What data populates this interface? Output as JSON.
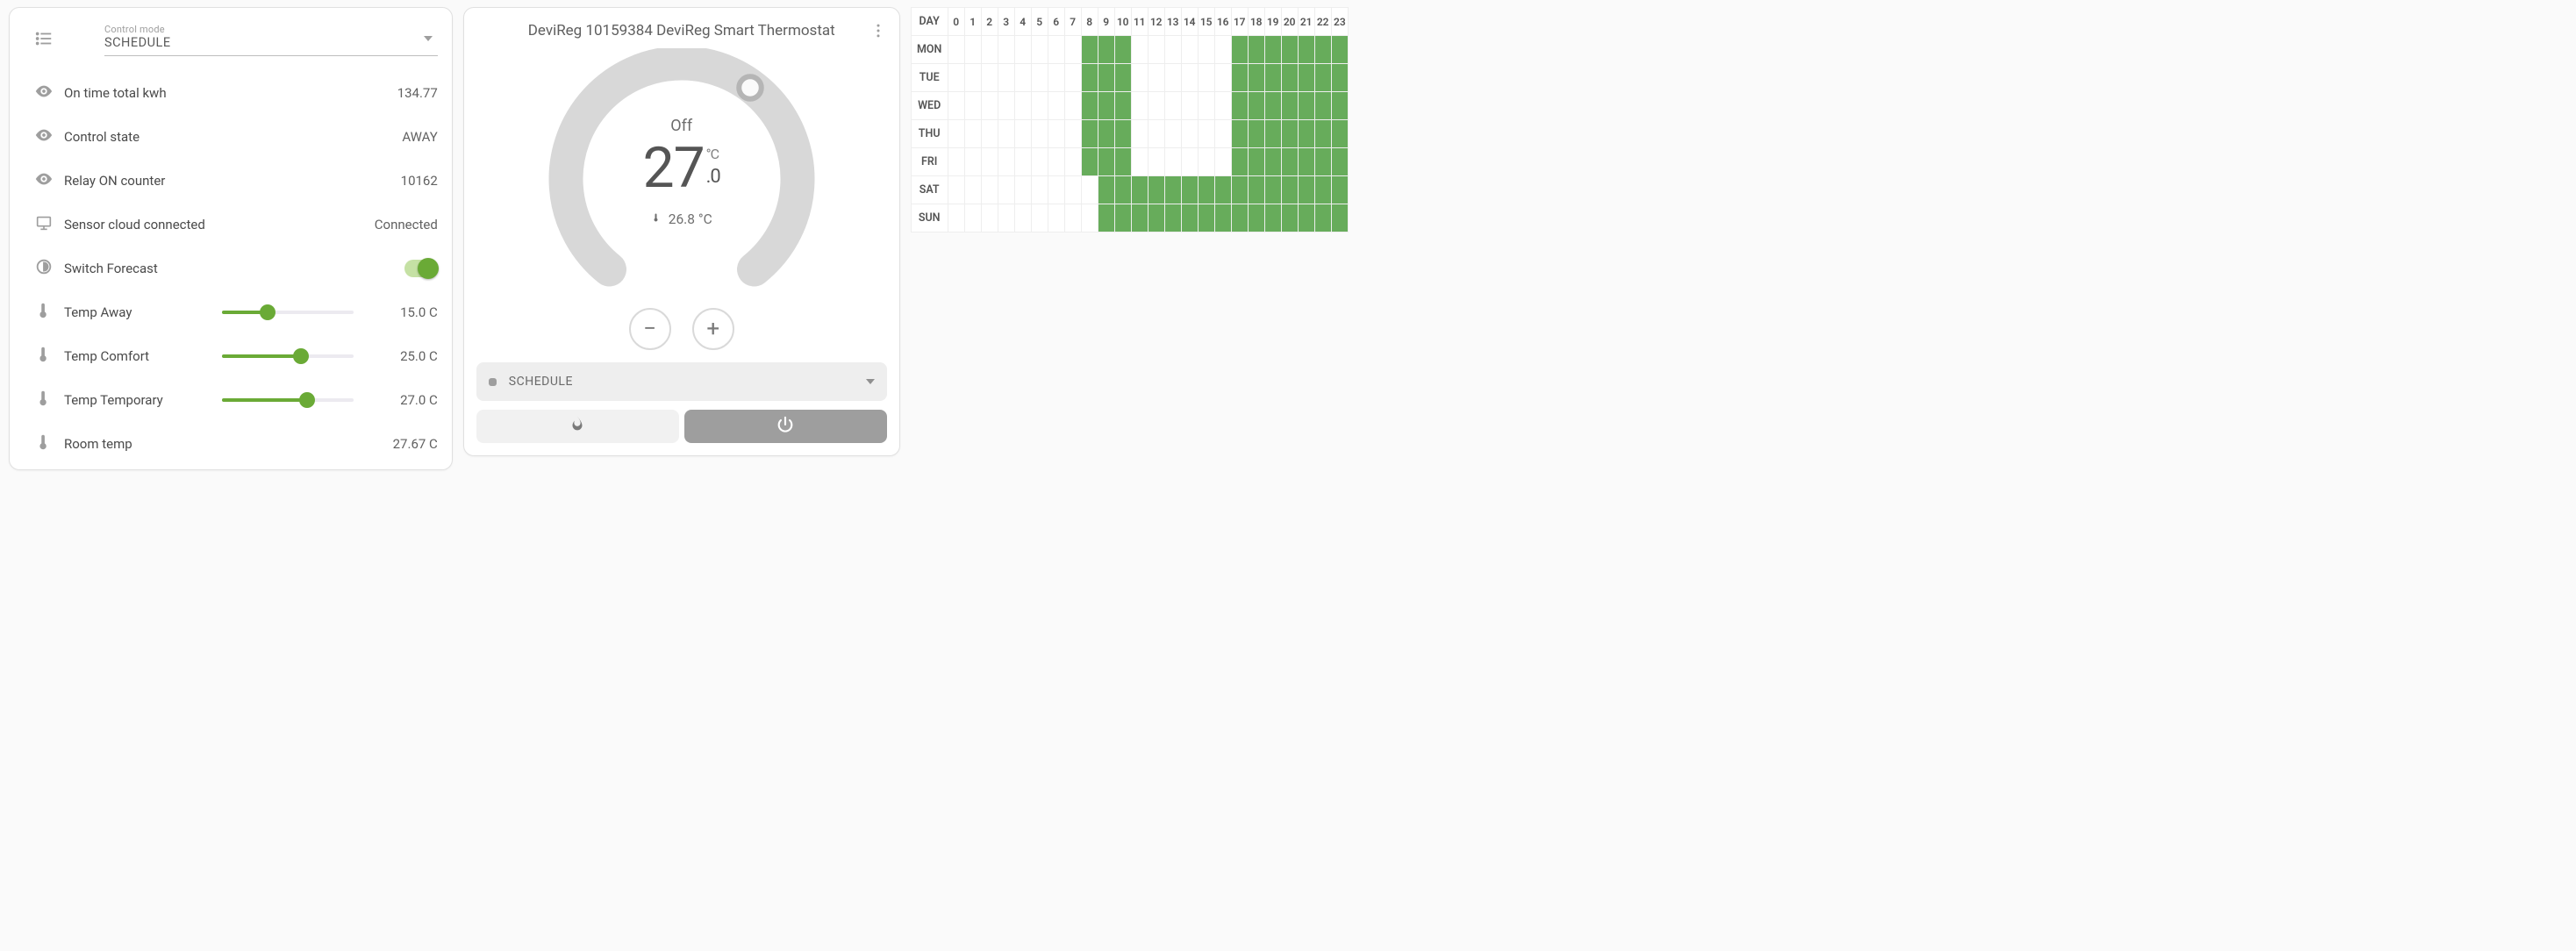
{
  "left": {
    "control_mode_label": "Control mode",
    "control_mode_value": "SCHEDULE",
    "rows": {
      "kwh": {
        "label": "On time total kwh",
        "value": "134.77"
      },
      "state": {
        "label": "Control state",
        "value": "AWAY"
      },
      "relay": {
        "label": "Relay ON counter",
        "value": "10162"
      },
      "cloud": {
        "label": "Sensor cloud connected",
        "value": "Connected"
      },
      "forecast": {
        "label": "Switch Forecast",
        "on": true
      },
      "away": {
        "label": "Temp Away",
        "value": "15.0 C",
        "pct": 35
      },
      "comfort": {
        "label": "Temp Comfort",
        "value": "25.0 C",
        "pct": 60
      },
      "temporary": {
        "label": "Temp Temporary",
        "value": "27.0 C",
        "pct": 65
      },
      "room": {
        "label": "Room temp",
        "value": "27.67 C"
      }
    }
  },
  "thermostat": {
    "title": "DeviReg 10159384 DeviReg Smart Thermostat",
    "state": "Off",
    "target_whole": "27",
    "target_dec": ".0",
    "target_unit": "°C",
    "current": "26.8 °C",
    "mode_label": "SCHEDULE"
  },
  "schedule": {
    "day_header": "DAY",
    "hours": [
      "0",
      "1",
      "2",
      "3",
      "4",
      "5",
      "6",
      "7",
      "8",
      "9",
      "10",
      "11",
      "12",
      "13",
      "14",
      "15",
      "16",
      "17",
      "18",
      "19",
      "20",
      "21",
      "22",
      "23"
    ],
    "rows": [
      {
        "name": "MON",
        "on": [
          8,
          9,
          10,
          17,
          18,
          19,
          20,
          21,
          22,
          23
        ]
      },
      {
        "name": "TUE",
        "on": [
          8,
          9,
          10,
          17,
          18,
          19,
          20,
          21,
          22,
          23
        ]
      },
      {
        "name": "WED",
        "on": [
          8,
          9,
          10,
          17,
          18,
          19,
          20,
          21,
          22,
          23
        ]
      },
      {
        "name": "THU",
        "on": [
          8,
          9,
          10,
          17,
          18,
          19,
          20,
          21,
          22,
          23
        ]
      },
      {
        "name": "FRI",
        "on": [
          8,
          9,
          10,
          17,
          18,
          19,
          20,
          21,
          22,
          23
        ]
      },
      {
        "name": "SAT",
        "on": [
          9,
          10,
          11,
          12,
          13,
          14,
          15,
          16,
          17,
          18,
          19,
          20,
          21,
          22,
          23
        ]
      },
      {
        "name": "SUN",
        "on": [
          9,
          10,
          11,
          12,
          13,
          14,
          15,
          16,
          17,
          18,
          19,
          20,
          21,
          22,
          23
        ]
      }
    ]
  }
}
